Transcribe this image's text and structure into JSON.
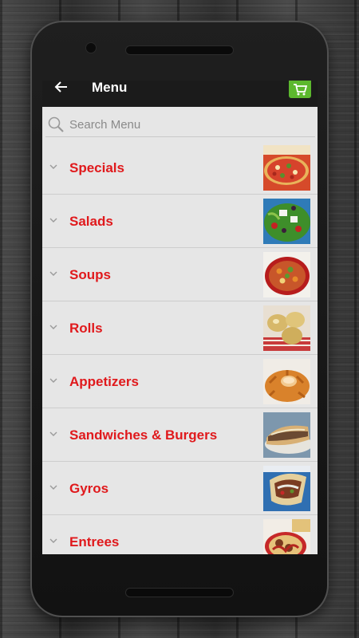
{
  "header": {
    "title": "Menu",
    "back_icon": "arrow-left-icon",
    "cart_icon": "cart-icon"
  },
  "search": {
    "placeholder": "Search Menu"
  },
  "categories": [
    {
      "label": "Specials",
      "image": "pizza"
    },
    {
      "label": "Salads",
      "image": "salad"
    },
    {
      "label": "Soups",
      "image": "soup"
    },
    {
      "label": "Rolls",
      "image": "rolls"
    },
    {
      "label": "Appetizers",
      "image": "onion-blossom"
    },
    {
      "label": "Sandwiches & Burgers",
      "image": "sandwich"
    },
    {
      "label": "Gyros",
      "image": "gyro"
    },
    {
      "label": "Entrees",
      "image": "spaghetti"
    }
  ],
  "colors": {
    "accent": "#e0191c",
    "appbar": "#1b1b1b",
    "cart": "#5cb82e",
    "list_bg": "#e6e6e6"
  }
}
